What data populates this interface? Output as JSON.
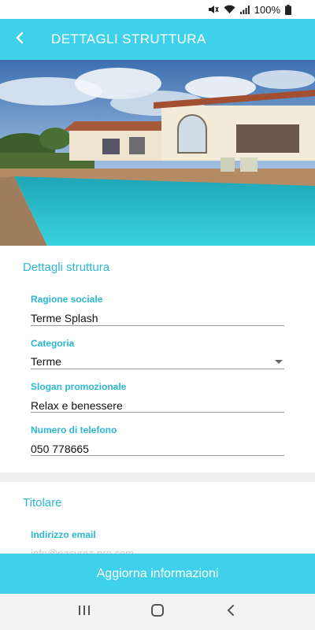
{
  "status_bar": {
    "battery_percent": "100%",
    "icons": [
      "mute-icon",
      "wifi-icon",
      "signal-icon",
      "battery-icon"
    ]
  },
  "app_bar": {
    "title": "DETTAGLI STRUTTURA",
    "back_icon": "back-arrow-icon"
  },
  "hero": {
    "subject": "villa-with-pool-photo"
  },
  "section_details": {
    "title": "Dettagli struttura",
    "fields": [
      {
        "label": "Ragione sociale",
        "value": "Terme Splash"
      },
      {
        "label": "Categoria",
        "value": "Terme"
      },
      {
        "label": "Slogan promozionale",
        "value": "Relax e benessere"
      },
      {
        "label": "Numero di telefono",
        "value": "050 778665"
      }
    ]
  },
  "section_owner": {
    "title": "Titolare",
    "fields": [
      {
        "label": "Indirizzo email",
        "value": "info@easyrez-pro.com"
      }
    ]
  },
  "action": {
    "label": "Aggiorna informazioni"
  },
  "colors": {
    "accent": "#3fd1ec",
    "label_accent": "#2bb8d3"
  },
  "nav_bar": {
    "icons": [
      "recent-apps-icon",
      "home-icon",
      "back-icon"
    ]
  }
}
